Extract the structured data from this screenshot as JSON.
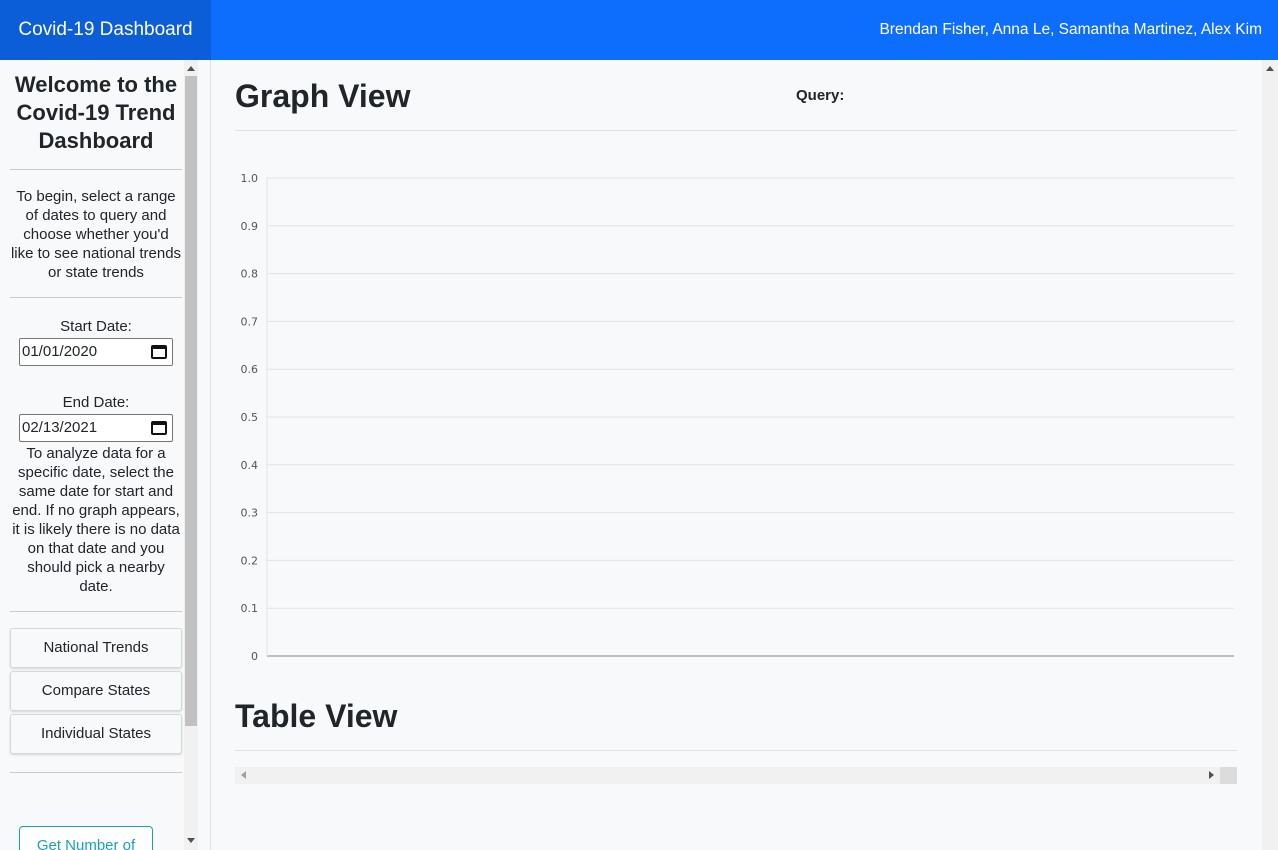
{
  "header": {
    "brand": "Covid-19 Dashboard",
    "authors": "Brendan Fisher, Anna Le, Samantha Martinez, Alex Kim"
  },
  "sidebar": {
    "welcome": "Welcome to the Covid-19 Trend Dashboard",
    "intro": "To begin, select a range of dates to query and choose whether you'd like to see national trends or state trends",
    "start_label": "Start Date:",
    "start_value": "01/01/2020",
    "end_label": "End Date:",
    "end_value": "02/13/2021",
    "note": "To analyze data for a specific date, select the same date for start and end. If no graph appears, it is likely there is no data on that date and you should pick a nearby date.",
    "buttons": [
      "National Trends",
      "Compare States",
      "Individual States"
    ],
    "extra_button": "Get Number of"
  },
  "main": {
    "graph_title": "Graph View",
    "query_label": "Query:",
    "table_title": "Table View"
  },
  "chart_data": {
    "type": "line",
    "series": [],
    "ylim": [
      0,
      1
    ],
    "yticks": [
      "0",
      "0.1",
      "0.2",
      "0.3",
      "0.4",
      "0.5",
      "0.6",
      "0.7",
      "0.8",
      "0.9",
      "1.0"
    ],
    "grid": true
  }
}
